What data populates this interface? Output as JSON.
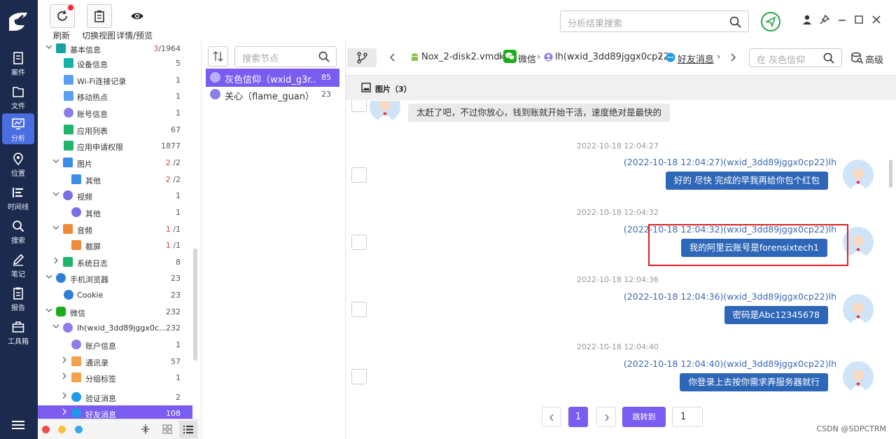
{
  "nav": {
    "items": [
      {
        "label": "案件",
        "icon": "case-icon"
      },
      {
        "label": "文件",
        "icon": "folder-icon"
      },
      {
        "label": "分析",
        "icon": "analysis-icon",
        "active": true
      },
      {
        "label": "位置",
        "icon": "location-icon"
      },
      {
        "label": "时间线",
        "icon": "timeline-icon"
      },
      {
        "label": "搜索",
        "icon": "search-icon"
      },
      {
        "label": "笔记",
        "icon": "note-icon"
      },
      {
        "label": "报告",
        "icon": "report-icon"
      },
      {
        "label": "工具箱",
        "icon": "toolbox-icon"
      }
    ]
  },
  "toolbar": {
    "refresh_label": "刷新",
    "switch_view_label": "切换视图",
    "detail_label": "详情/预览"
  },
  "header": {
    "search_placeholder": "分析结果搜索"
  },
  "tree": {
    "rows": [
      {
        "label": "基本信息",
        "count_red": "3",
        "count": "/1964"
      },
      {
        "label": "设备信息",
        "count": "5"
      },
      {
        "label": "Wi-Fi连接记录",
        "count": "1"
      },
      {
        "label": "移动热点",
        "count": "1"
      },
      {
        "label": "账号信息",
        "count": "1"
      },
      {
        "label": "应用列表",
        "count": "67"
      },
      {
        "label": "应用申请权限",
        "count": "1877"
      },
      {
        "label": "图片",
        "count_red": "2",
        "count": " /2"
      },
      {
        "label": "其他",
        "count_red": "2",
        "count": " /2"
      },
      {
        "label": "视频",
        "count": "1"
      },
      {
        "label": "其他",
        "count": "1"
      },
      {
        "label": "音频",
        "count_red": "1",
        "count": " /1"
      },
      {
        "label": "截屏",
        "count_red": "1",
        "count": " /1"
      },
      {
        "label": "系统日志",
        "count": "8"
      },
      {
        "label": "手机浏览器",
        "count": "23"
      },
      {
        "label": "Cookie",
        "count": "23"
      },
      {
        "label": "微信",
        "count": "232"
      },
      {
        "label": "lh(wxid_3dd89jggx0c...",
        "count": "232"
      },
      {
        "label": "账户信息",
        "count": "1"
      },
      {
        "label": "通讯录",
        "count": "57"
      },
      {
        "label": "分组标签",
        "count": "1"
      },
      {
        "label": "验证消息",
        "count": "2"
      },
      {
        "label": "好友消息",
        "count": "108"
      }
    ]
  },
  "contacts": {
    "search_placeholder": "搜索节点",
    "items": [
      {
        "name": "灰色信仰（wxid_g3r...",
        "count": "85"
      },
      {
        "name": "关心（flame_guan）",
        "count": "23"
      }
    ]
  },
  "breadcrumb": {
    "items": [
      "Nox_2-disk2.vmdk",
      "微信",
      "lh(wxid_3dd89jggx0cp22)",
      "好友消息"
    ],
    "search_placeholder": "在 灰色信仰",
    "advanced_label": "高级"
  },
  "tab": {
    "label": "图片（3）"
  },
  "messages": [
    {
      "side": "left",
      "text": "太赶了吧，不过你放心，钱到账就开始干活，速度绝对是最快的"
    },
    {
      "time": "2022-10-18 12:04:27",
      "sender": "(2022-10-18 12:04:27)(wxid_3dd89jggx0cp22)lh",
      "text": "好的 尽快 完成的早我再给你包个红包"
    },
    {
      "time": "2022-10-18 12:04:32",
      "sender": "(2022-10-18 12:04:32)(wxid_3dd89jggx0cp22)lh",
      "text": "我的阿里云账号是forensixtech1"
    },
    {
      "time": "2022-10-18 12:04:36",
      "sender": "(2022-10-18 12:04:36)(wxid_3dd89jggx0cp22)lh",
      "text": "密码是Abc12345678"
    },
    {
      "time": "2022-10-18 12:04:40",
      "sender": "(2022-10-18 12:04:40)(wxid_3dd89jggx0cp22)lh",
      "text": "你登录上去按你需求弄服务器就行"
    }
  ],
  "pagination": {
    "current": "1",
    "goto_label": "跳转到",
    "goto_value": "1"
  },
  "watermark": "CSDN @SDPCTRM",
  "colors": {
    "nav_bg": "#1c2a4d",
    "nav_active": "#4a6ee0",
    "accent": "#7a5cf0",
    "bubble": "#2e66b8",
    "highlight": "#e02020"
  }
}
